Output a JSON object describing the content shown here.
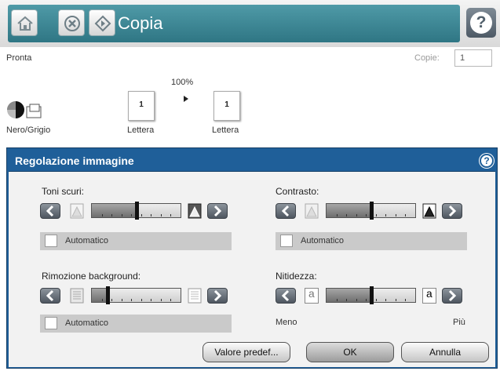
{
  "topbar": {
    "title": "Copia",
    "home_icon": "home-icon",
    "stop_icon": "stop-icon",
    "start_icon": "start-icon",
    "help_icon": "help-icon",
    "help_symbol": "?"
  },
  "status": {
    "state": "Pronta",
    "copies_label": "Copie:",
    "copies_value": "1"
  },
  "preview": {
    "zoom": "100%",
    "color_mode_label": "Nero/Grigio",
    "original": {
      "count": "1",
      "size": "Lettera"
    },
    "output": {
      "count": "1",
      "size": "Lettera"
    }
  },
  "dialog": {
    "title": "Regolazione immagine",
    "help_symbol": "?",
    "controls": {
      "darkness": {
        "label": "Toni scuri:",
        "level": 0.5,
        "auto_label": "Automatico"
      },
      "contrast": {
        "label": "Contrasto:",
        "level": 0.5,
        "auto_label": "Automatico"
      },
      "background": {
        "label": "Rimozione background:",
        "level": 0.18,
        "auto_label": "Automatico"
      },
      "sharpness": {
        "label": "Nitidezza:",
        "level": 0.5,
        "letter": "a",
        "min_label": "Meno",
        "max_label": "Più"
      }
    },
    "buttons": {
      "defaults": "Valore predef...",
      "ok": "OK",
      "cancel": "Annulla"
    }
  },
  "colors": {
    "topbar_teal": "#3a8593",
    "dialog_blue": "#1f5f99",
    "panel_bg": "#f2f2f2"
  }
}
